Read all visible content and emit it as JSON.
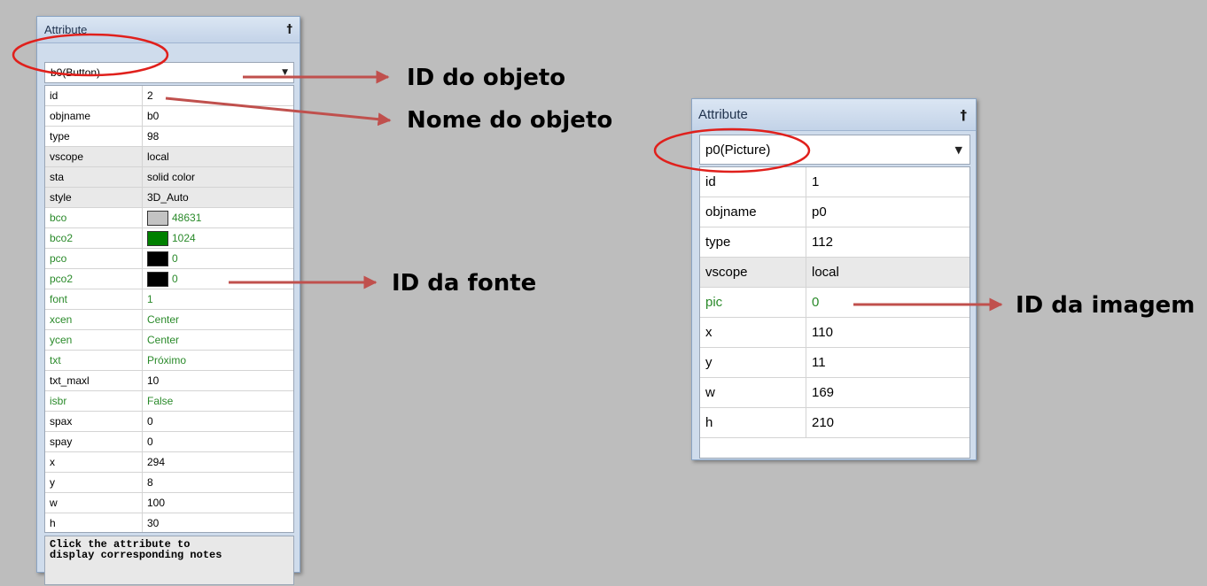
{
  "left_panel": {
    "title": "Attribute",
    "pin_glyph": "†",
    "combo_value": "b0(Button)",
    "combo_arrow": "▼",
    "rows": [
      {
        "name": "id",
        "value": "2"
      },
      {
        "name": "objname",
        "value": "b0"
      },
      {
        "name": "type",
        "value": "98"
      },
      {
        "name": "vscope",
        "value": "local"
      },
      {
        "name": "sta",
        "value": "solid color"
      },
      {
        "name": "style",
        "value": "3D_Auto"
      },
      {
        "name": "bco",
        "value": "48631",
        "swatch": "#c3c3c3"
      },
      {
        "name": "bco2",
        "value": "1024",
        "swatch": "#008000"
      },
      {
        "name": "pco",
        "value": "0",
        "swatch": "#000000"
      },
      {
        "name": "pco2",
        "value": "0",
        "swatch": "#000000"
      },
      {
        "name": "font",
        "value": "1"
      },
      {
        "name": "xcen",
        "value": "Center"
      },
      {
        "name": "ycen",
        "value": "Center"
      },
      {
        "name": "txt",
        "value": "Próximo"
      },
      {
        "name": "txt_maxl",
        "value": "10"
      },
      {
        "name": "isbr",
        "value": "False"
      },
      {
        "name": "spax",
        "value": "0"
      },
      {
        "name": "spay",
        "value": "0"
      },
      {
        "name": "x",
        "value": "294"
      },
      {
        "name": "y",
        "value": "8"
      },
      {
        "name": "w",
        "value": "100"
      },
      {
        "name": "h",
        "value": "30"
      }
    ],
    "notes": "Click the attribute to\ndisplay corresponding notes"
  },
  "right_panel": {
    "title": "Attribute",
    "pin_glyph": "†",
    "combo_value": "p0(Picture)",
    "combo_arrow": "▼",
    "rows": [
      {
        "name": "id",
        "value": "1"
      },
      {
        "name": "objname",
        "value": "p0"
      },
      {
        "name": "type",
        "value": "112"
      },
      {
        "name": "vscope",
        "value": "local"
      },
      {
        "name": "pic",
        "value": "0"
      },
      {
        "name": "x",
        "value": "110"
      },
      {
        "name": "y",
        "value": "11"
      },
      {
        "name": "w",
        "value": "169"
      },
      {
        "name": "h",
        "value": "210"
      }
    ]
  },
  "annotations": {
    "id_objeto": "ID do objeto",
    "nome_objeto": "Nome do objeto",
    "id_fonte": "ID da fonte",
    "id_imagem": "ID da imagem",
    "arrow_color": "#c0504d",
    "circle_color": "#e0201c"
  },
  "colors": {
    "green_text": "#2a8a2a",
    "shaded_row": "#e9e9e9"
  }
}
